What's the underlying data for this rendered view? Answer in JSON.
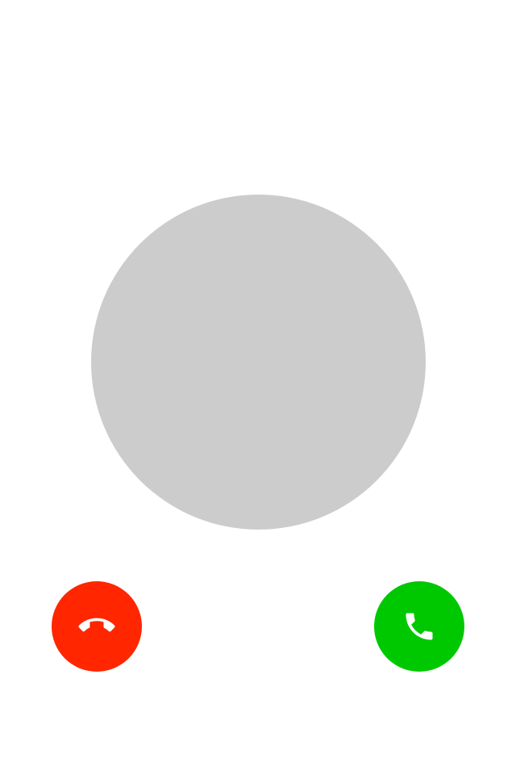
{
  "colors": {
    "background": "#ffffff",
    "avatar_placeholder": "#cccccc",
    "decline": "#ff2600",
    "accept": "#00c800",
    "icon": "#ffffff"
  },
  "avatar": {
    "icon": "avatar-placeholder"
  },
  "actions": {
    "decline": {
      "icon": "phone-hangup-icon"
    },
    "accept": {
      "icon": "phone-icon"
    }
  }
}
